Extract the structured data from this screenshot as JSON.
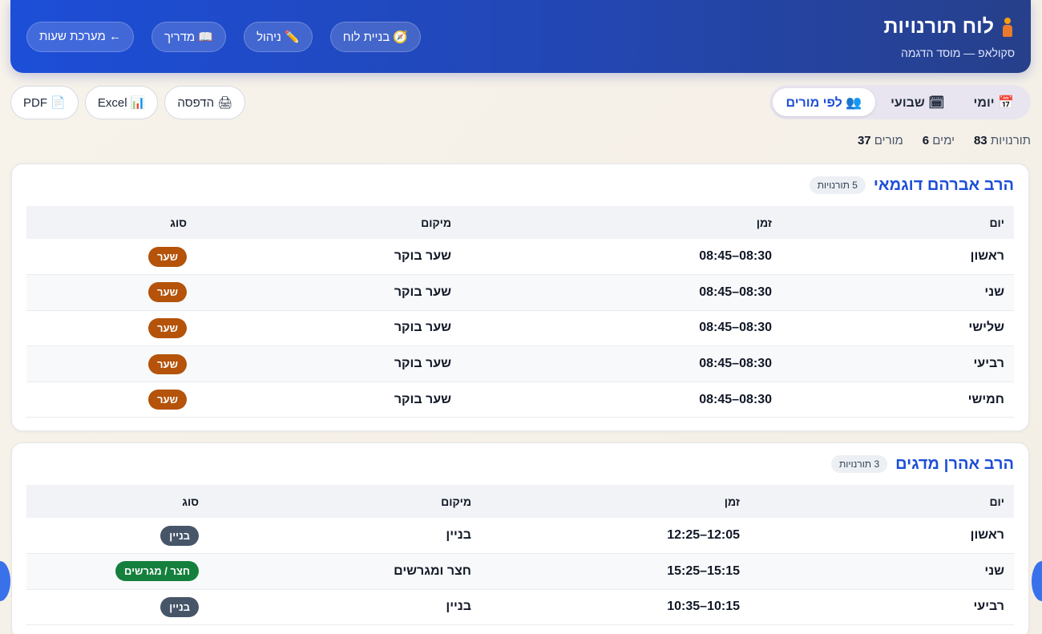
{
  "header": {
    "title": "לוח תורנויות",
    "subtitle": "סקולאפ — מוסד הדגמה",
    "nav": [
      {
        "label": "🧭 בניית לוח"
      },
      {
        "label": "✏️ ניהול"
      },
      {
        "label": "📖 מדריך"
      },
      {
        "label": "← מערכת שעות"
      }
    ]
  },
  "view_tabs": [
    {
      "label": "📅 יומי",
      "active": false
    },
    {
      "label": "🗓 שבועי",
      "active": false
    },
    {
      "label": "👥 לפי מורים",
      "active": true
    }
  ],
  "export": [
    {
      "label": "📄 PDF"
    },
    {
      "label": "📊 Excel"
    },
    {
      "label": "🖨 הדפסה"
    }
  ],
  "stats": [
    {
      "value": "83",
      "label": "תורנויות"
    },
    {
      "value": "6",
      "label": "ימים"
    },
    {
      "value": "37",
      "label": "מורים"
    }
  ],
  "columns": [
    "יום",
    "זמן",
    "מיקום",
    "סוג"
  ],
  "colors": {
    "gate": "#b45309",
    "building": "#475569",
    "yard": "#15803d"
  },
  "teachers": [
    {
      "name": "הרב אברהם דוגמאי",
      "count": "5 תורנויות",
      "rows": [
        {
          "day": "ראשון",
          "time": "08:30–08:45",
          "location": "שער בוקר",
          "type": "שער"
        },
        {
          "day": "שני",
          "time": "08:30–08:45",
          "location": "שער בוקר",
          "type": "שער"
        },
        {
          "day": "שלישי",
          "time": "08:30–08:45",
          "location": "שער בוקר",
          "type": "שער"
        },
        {
          "day": "רביעי",
          "time": "08:30–08:45",
          "location": "שער בוקר",
          "type": "שער"
        },
        {
          "day": "חמישי",
          "time": "08:30–08:45",
          "location": "שער בוקר",
          "type": "שער"
        }
      ]
    },
    {
      "name": "הרב אהרן מדגים",
      "count": "3 תורנויות",
      "rows": [
        {
          "day": "ראשון",
          "time": "12:05–12:25",
          "location": "בניין",
          "type": "בניין"
        },
        {
          "day": "שני",
          "time": "15:15–15:25",
          "location": "חצר ומגרשים",
          "type": "חצר / מגרשים"
        },
        {
          "day": "רביעי",
          "time": "10:15–10:35",
          "location": "בניין",
          "type": "בניין"
        }
      ]
    }
  ]
}
